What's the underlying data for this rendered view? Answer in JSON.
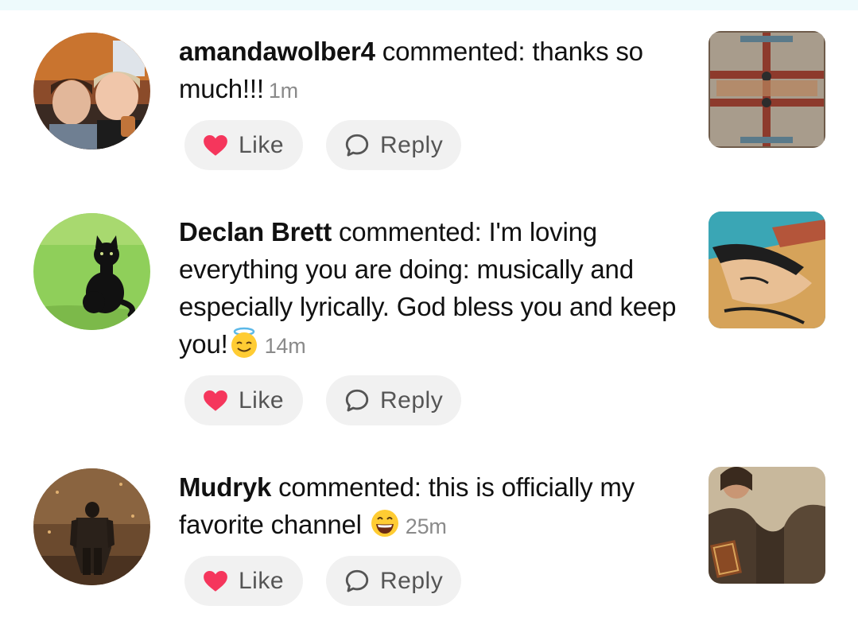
{
  "comments": [
    {
      "user": "amandawolber4",
      "verb": " commented: ",
      "text": "thanks so much!!!",
      "emoji": "",
      "time": "1m",
      "like_label": "Like",
      "reply_label": "Reply",
      "avatar_icon": "avatar-photo-family",
      "thumbnail_icon": "thumbnail-ornate-panel"
    },
    {
      "user": "Declan Brett",
      "verb": " commented: ",
      "text": "I'm loving everything you are doing: musically and especially lyrically. God bless you and keep you!",
      "emoji": "smiling-face-with-halo-emoji",
      "time": "14m",
      "like_label": "Like",
      "reply_label": "Reply",
      "avatar_icon": "avatar-photo-black-cat",
      "thumbnail_icon": "thumbnail-painted-face"
    },
    {
      "user": "Mudryk",
      "verb": " commented: ",
      "text": "this is officially my favorite channel ",
      "emoji": "grinning-face-emoji",
      "time": "25m",
      "like_label": "Like",
      "reply_label": "Reply",
      "avatar_icon": "avatar-photo-armored-warrior",
      "thumbnail_icon": "thumbnail-monk-with-book"
    }
  ],
  "colors": {
    "heart": "#f5365c",
    "button_bg": "#f1f1f1",
    "time_text": "#8a8a8a",
    "top_strip": "#eefafc"
  }
}
